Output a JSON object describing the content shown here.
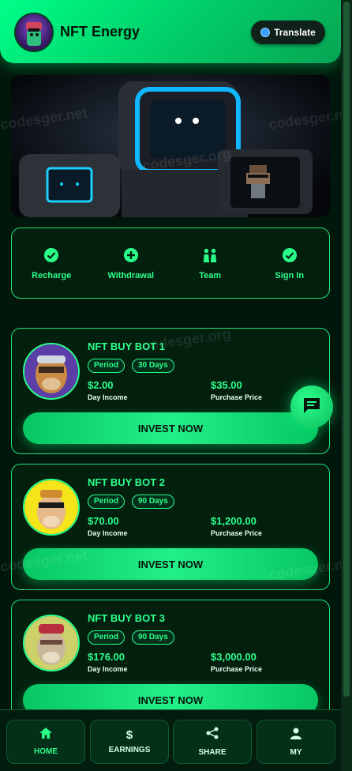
{
  "header": {
    "title": "NFT Energy",
    "translate_label": "Translate"
  },
  "actions": [
    {
      "label": "Recharge",
      "icon": "check-circle-icon"
    },
    {
      "label": "Withdrawal",
      "icon": "plus-circle-icon"
    },
    {
      "label": "Team",
      "icon": "team-icon"
    },
    {
      "label": "Sign In",
      "icon": "check-circle-icon"
    }
  ],
  "products": [
    {
      "name": "NFT BUY BOT 1",
      "tag1": "Period",
      "tag2": "30 Days",
      "income": "$2.00",
      "income_label": "Day Income",
      "price": "$35.00",
      "price_label": "Purchase Price",
      "button": "INVEST NOW"
    },
    {
      "name": "NFT BUY BOT 2",
      "tag1": "Period",
      "tag2": "90 Days",
      "income": "$70.00",
      "income_label": "Day Income",
      "price": "$1,200.00",
      "price_label": "Purchase Price",
      "button": "INVEST NOW"
    },
    {
      "name": "NFT BUY BOT 3",
      "tag1": "Period",
      "tag2": "90 Days",
      "income": "$176.00",
      "income_label": "Day Income",
      "price": "$3,000.00",
      "price_label": "Purchase Price",
      "button": "INVEST NOW"
    }
  ],
  "nav": [
    {
      "label": "HOME",
      "icon": "home-icon",
      "active": true
    },
    {
      "label": "EARNINGS",
      "icon": "dollar-icon",
      "active": false
    },
    {
      "label": "SHARE",
      "icon": "share-icon",
      "active": false
    },
    {
      "label": "MY",
      "icon": "user-icon",
      "active": false
    }
  ],
  "watermarks": [
    "codesger.net",
    "codesger.org"
  ],
  "colors": {
    "accent": "#2bff8a",
    "background": "#02170c",
    "header": "#00d46c"
  }
}
